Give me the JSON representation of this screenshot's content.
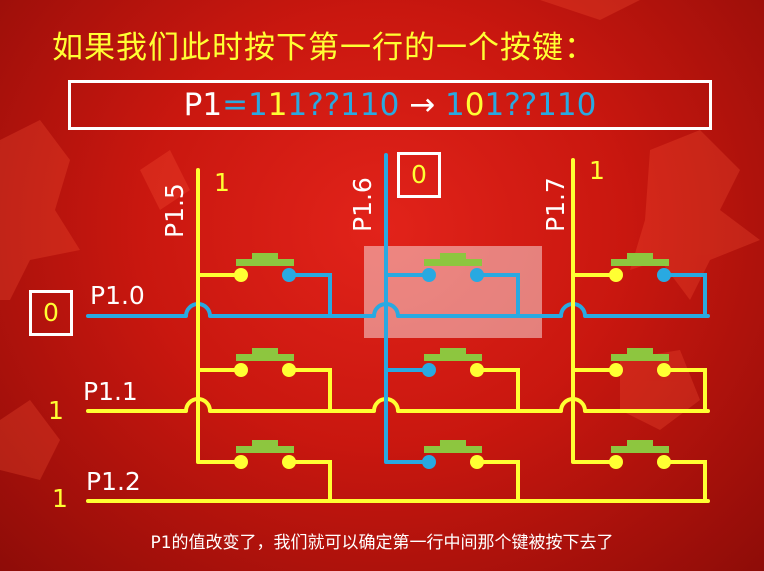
{
  "title": "如果我们此时按下第一行的一个按键：",
  "equation": {
    "lhs": "P1",
    "eq": "=",
    "p1": "1",
    "p2": "1",
    "p3": "1",
    "q": "??",
    "p4": "110",
    "arrow": "→",
    "r1": "1",
    "r2": "0",
    "r3": "1",
    "rq": "??",
    "r4": "110"
  },
  "columns": [
    {
      "label": "P1.5",
      "value": "1"
    },
    {
      "label": "P1.6",
      "value": "0"
    },
    {
      "label": "P1.7",
      "value": "1"
    }
  ],
  "rows": [
    {
      "label": "P1.0",
      "value": "0"
    },
    {
      "label": "P1.1",
      "value": "1"
    },
    {
      "label": "P1.2",
      "value": "1"
    }
  ],
  "caption": "P1的值改变了，我们就可以确定第一行中间那个键被按下去了",
  "colors": {
    "yellow": "#ffff33",
    "blue": "#29a9e1",
    "green": "#8dc63f",
    "background": "#c9170f"
  }
}
